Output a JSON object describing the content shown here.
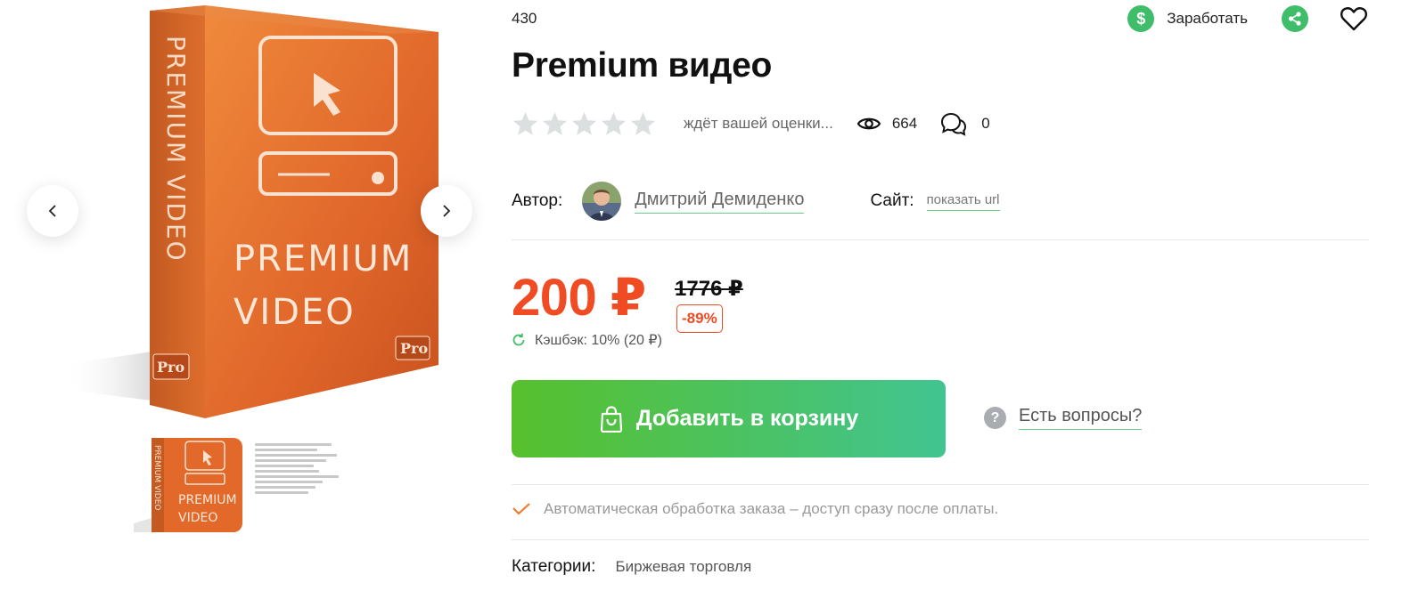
{
  "product": {
    "sku": "430",
    "title": "Premium видео",
    "image_text": {
      "spine": "PREMIUM VIDEO",
      "front_line1": "PREMIUM",
      "front_line2": "VIDEO",
      "badge": "Pro"
    }
  },
  "top_actions": {
    "earn_label": "Заработать",
    "earn_icon": "dollar-icon",
    "share_icon": "share-icon",
    "favorite_icon": "heart-icon"
  },
  "rating": {
    "stars_filled": 0,
    "stars_total": 5,
    "hint": "ждёт вашей оценки...",
    "views": "664",
    "comments": "0"
  },
  "author": {
    "label": "Автор:",
    "name": "Дмитрий Демиденко",
    "site_label": "Сайт:",
    "site_link": "показать url"
  },
  "pricing": {
    "price": "200 ₽",
    "old_price": "1776 ₽",
    "discount": "-89%",
    "cashback": "Кэшбэк: 10% (20 ₽)"
  },
  "actions": {
    "add_to_cart": "Добавить в корзину",
    "questions": "Есть вопросы?"
  },
  "auto_processing": "Автоматическая обработка заказа – доступ сразу после оплаты.",
  "categories": {
    "label": "Категории:",
    "value": "Биржевая торговля"
  },
  "colors": {
    "accent_green": "#3fbd6a",
    "price_red": "#f04b23",
    "box_orange": "#e2692a"
  }
}
